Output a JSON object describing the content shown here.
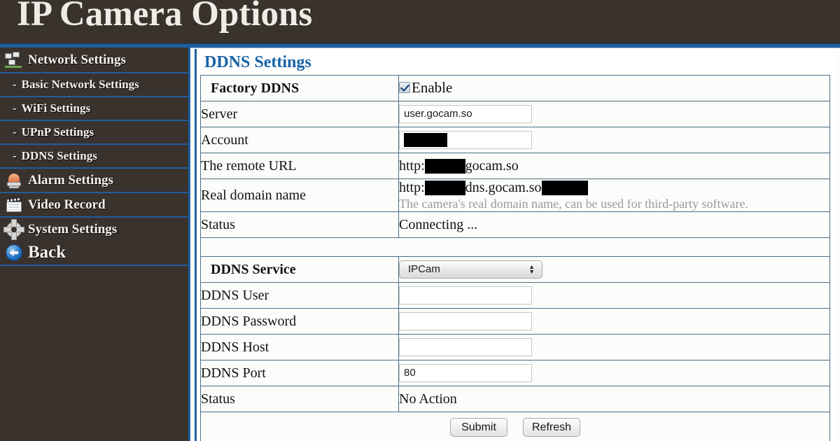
{
  "header": {
    "title": "IP Camera Options"
  },
  "sidebar": {
    "items": [
      {
        "label": "Network Settings",
        "icon": "network-icon",
        "type": "main"
      },
      {
        "label": "Basic Network Settings",
        "icon": "dash",
        "type": "sub"
      },
      {
        "label": "WiFi Settings",
        "icon": "dash",
        "type": "sub"
      },
      {
        "label": "UPnP Settings",
        "icon": "dash",
        "type": "sub"
      },
      {
        "label": "DDNS Settings",
        "icon": "dash",
        "type": "sub"
      },
      {
        "label": "Alarm Settings",
        "icon": "alarm-icon",
        "type": "main"
      },
      {
        "label": "Video Record",
        "icon": "film-icon",
        "type": "main"
      },
      {
        "label": "System Settings",
        "icon": "gear-icon",
        "type": "main"
      },
      {
        "label": "Back",
        "icon": "back-arrow-icon",
        "type": "back"
      }
    ],
    "dash_glyph": "-"
  },
  "panel": {
    "title": "DDNS Settings"
  },
  "factory_ddns": {
    "label": "Factory DDNS",
    "checkbox_label": "Enable",
    "checked": true,
    "rows": [
      {
        "label": "Server",
        "value": "user.gocam.so",
        "kind": "input"
      },
      {
        "label": "Account",
        "value": "",
        "kind": "input-redacted"
      },
      {
        "label": "The remote URL",
        "value": "",
        "kind": "url"
      },
      {
        "label": "Real domain name",
        "value": "",
        "kind": "url-hint"
      },
      {
        "label": "Status",
        "value": "Connecting ...",
        "kind": "text"
      }
    ],
    "remote_url": {
      "prefix": "http:",
      "suffix": "gocam.so"
    },
    "real_domain": {
      "prefix": "http:",
      "middle": "dns.gocam.so"
    },
    "real_domain_hint": "The camera's real domain name, can be used for third-party software."
  },
  "ddns_service": {
    "label": "DDNS Service",
    "selected": "IPCam",
    "arrows": "▲▼",
    "rows": [
      {
        "label": "DDNS User",
        "value": "",
        "kind": "input"
      },
      {
        "label": "DDNS Password",
        "value": "",
        "kind": "input"
      },
      {
        "label": "DDNS Host",
        "value": "",
        "kind": "input"
      },
      {
        "label": "DDNS Port",
        "value": "80",
        "kind": "input"
      },
      {
        "label": "Status",
        "value": "No Action",
        "kind": "text"
      }
    ]
  },
  "buttons": {
    "submit": "Submit",
    "refresh": "Refresh"
  },
  "colors": {
    "header_bg": "#3a322d",
    "accent_blue": "#1f5f9e",
    "panel_title": "#1763a6",
    "table_border": "#4a6f86",
    "hint_text": "#9a9a9a"
  }
}
